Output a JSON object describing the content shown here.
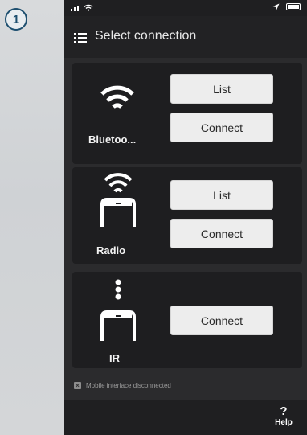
{
  "step": "1",
  "status_bar": {
    "wifi_icon": "wifi-icon",
    "location_icon": "location-arrow-icon",
    "battery_icon": "battery-icon"
  },
  "header": {
    "title": "Select connection",
    "menu_icon": "hamburger-menu-icon"
  },
  "connections": [
    {
      "label": "Bluetoo...",
      "icon": "wifi-icon",
      "buttons": [
        "List",
        "Connect"
      ]
    },
    {
      "label": "Radio",
      "icon": "radio-device-icon",
      "buttons": [
        "List",
        "Connect"
      ]
    },
    {
      "label": "IR",
      "icon": "ir-device-icon",
      "buttons": [
        "Connect"
      ]
    }
  ],
  "status_message": "Mobile interface disconnected",
  "footer": {
    "help_symbol": "?",
    "help_label": "Help"
  },
  "colors": {
    "badge_border": "#1e4f6f",
    "card_bg": "#1e1e20",
    "button_bg": "#ededed",
    "phone_bg": "#2b2b2d"
  }
}
